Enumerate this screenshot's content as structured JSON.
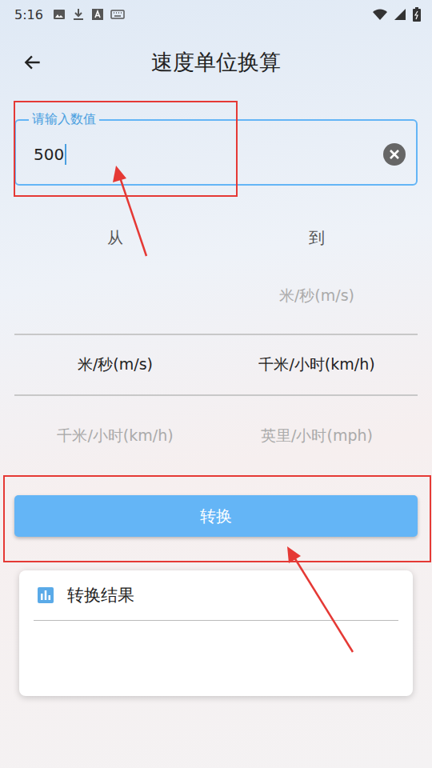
{
  "status_bar": {
    "time": "5:16"
  },
  "header": {
    "title": "速度单位换算"
  },
  "input": {
    "label": "请输入数值",
    "value": "500",
    "focused": true
  },
  "picker": {
    "columns": [
      {
        "label": "从",
        "options": [
          {
            "text": "米/秒(m/s)",
            "selected": true
          },
          {
            "text": "千米/小时(km/h)",
            "selected": false
          }
        ]
      },
      {
        "label": "到",
        "options": [
          {
            "text": "米/秒(m/s)",
            "selected": false
          },
          {
            "text": "千米/小时(km/h)",
            "selected": true
          },
          {
            "text": "英里/小时(mph)",
            "selected": false
          }
        ]
      }
    ]
  },
  "buttons": [
    "转换"
  ],
  "result": {
    "title": "转换结果",
    "text": ""
  }
}
